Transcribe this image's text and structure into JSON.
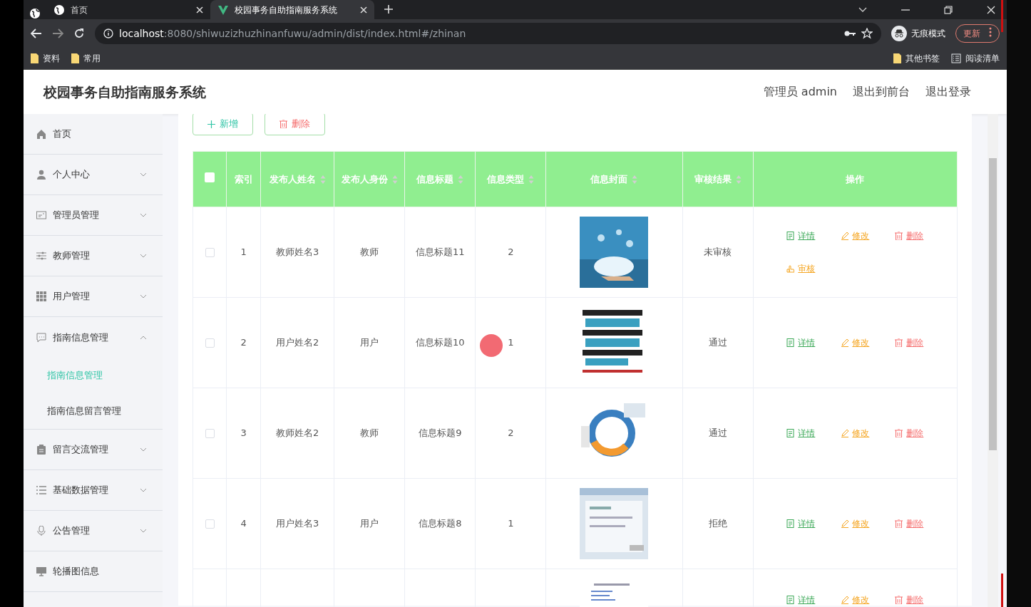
{
  "browser": {
    "tabs": [
      {
        "title": "首页",
        "selected": false
      },
      {
        "title": "校园事务自助指南服务系统",
        "selected": true
      }
    ],
    "url_host": "localhost",
    "url_rest": ":8080/shiwuzizhuzhinanfuwu/admin/dist/index.html#/zhinan",
    "profile_label": "无痕模式",
    "update_button": "更新",
    "bookmarks": [
      "资料",
      "常用"
    ],
    "bookmarks_right": [
      "其他书签",
      "阅读清单"
    ]
  },
  "header": {
    "title": "校园事务自助指南服务系统",
    "links": [
      "管理员 admin",
      "退出到前台",
      "退出登录"
    ]
  },
  "sidebar": {
    "items": [
      {
        "label": "首页",
        "kind": "link"
      },
      {
        "label": "个人中心",
        "kind": "menu",
        "expanded": false
      },
      {
        "label": "管理员管理",
        "kind": "menu",
        "expanded": false
      },
      {
        "label": "教师管理",
        "kind": "menu",
        "expanded": false
      },
      {
        "label": "用户管理",
        "kind": "menu",
        "expanded": false
      },
      {
        "label": "指南信息管理",
        "kind": "menu",
        "expanded": true,
        "children": [
          {
            "label": "指南信息管理",
            "selected": true
          },
          {
            "label": "指南信息留言管理",
            "selected": false
          }
        ]
      },
      {
        "label": "留言交流管理",
        "kind": "menu",
        "expanded": false
      },
      {
        "label": "基础数据管理",
        "kind": "menu",
        "expanded": false
      },
      {
        "label": "公告管理",
        "kind": "menu",
        "expanded": false
      },
      {
        "label": "轮播图信息",
        "kind": "link"
      }
    ]
  },
  "toolbar": [
    {
      "label": "新增",
      "kind": "add"
    },
    {
      "label": "删除",
      "kind": "delete"
    }
  ],
  "table": {
    "select_all": {
      "checked": false
    },
    "columns": [
      {
        "label": "索引",
        "sortable": false
      },
      {
        "label": "发布人姓名",
        "sortable": true
      },
      {
        "label": "发布人身份",
        "sortable": true
      },
      {
        "label": "信息标题",
        "sortable": true
      },
      {
        "label": "信息类型",
        "sortable": true
      },
      {
        "label": "信息封面",
        "sortable": true
      },
      {
        "label": "审核结果",
        "sortable": true
      },
      {
        "label": "操作",
        "sortable": false
      }
    ],
    "rows": [
      {
        "checked": false,
        "cells": [
          "1",
          "教师姓名3",
          "教师",
          "信息标题11",
          "2"
        ],
        "cover": {
          "kind": "picture"
        },
        "review": "未审核",
        "actions": [
          {
            "label": "详情",
            "kind": "detail"
          },
          {
            "label": "修改",
            "kind": "edit"
          },
          {
            "label": "删除",
            "kind": "delete"
          },
          {
            "label": "审核",
            "kind": "review"
          }
        ]
      },
      {
        "checked": false,
        "cells": [
          "2",
          "用户姓名2",
          "用户",
          "信息标题10",
          "1"
        ],
        "cover": {
          "kind": "picture"
        },
        "review": "通过",
        "actions": [
          {
            "label": "详情",
            "kind": "detail"
          },
          {
            "label": "修改",
            "kind": "edit"
          },
          {
            "label": "删除",
            "kind": "delete"
          }
        ]
      },
      {
        "checked": false,
        "cells": [
          "3",
          "教师姓名2",
          "教师",
          "信息标题9",
          "2"
        ],
        "cover": {
          "kind": "picture"
        },
        "review": "通过",
        "actions": [
          {
            "label": "详情",
            "kind": "detail"
          },
          {
            "label": "修改",
            "kind": "edit"
          },
          {
            "label": "删除",
            "kind": "delete"
          }
        ]
      },
      {
        "checked": false,
        "cells": [
          "4",
          "用户姓名3",
          "用户",
          "信息标题8",
          "1"
        ],
        "cover": {
          "kind": "picture"
        },
        "review": "拒绝",
        "actions": [
          {
            "label": "详情",
            "kind": "detail"
          },
          {
            "label": "修改",
            "kind": "edit"
          },
          {
            "label": "删除",
            "kind": "delete"
          }
        ]
      },
      {
        "cover": {
          "kind": "picture"
        },
        "actions": [
          {
            "label": "详情",
            "kind": "detail"
          },
          {
            "label": "修改",
            "kind": "edit"
          },
          {
            "label": "删除",
            "kind": "delete"
          }
        ]
      }
    ]
  }
}
